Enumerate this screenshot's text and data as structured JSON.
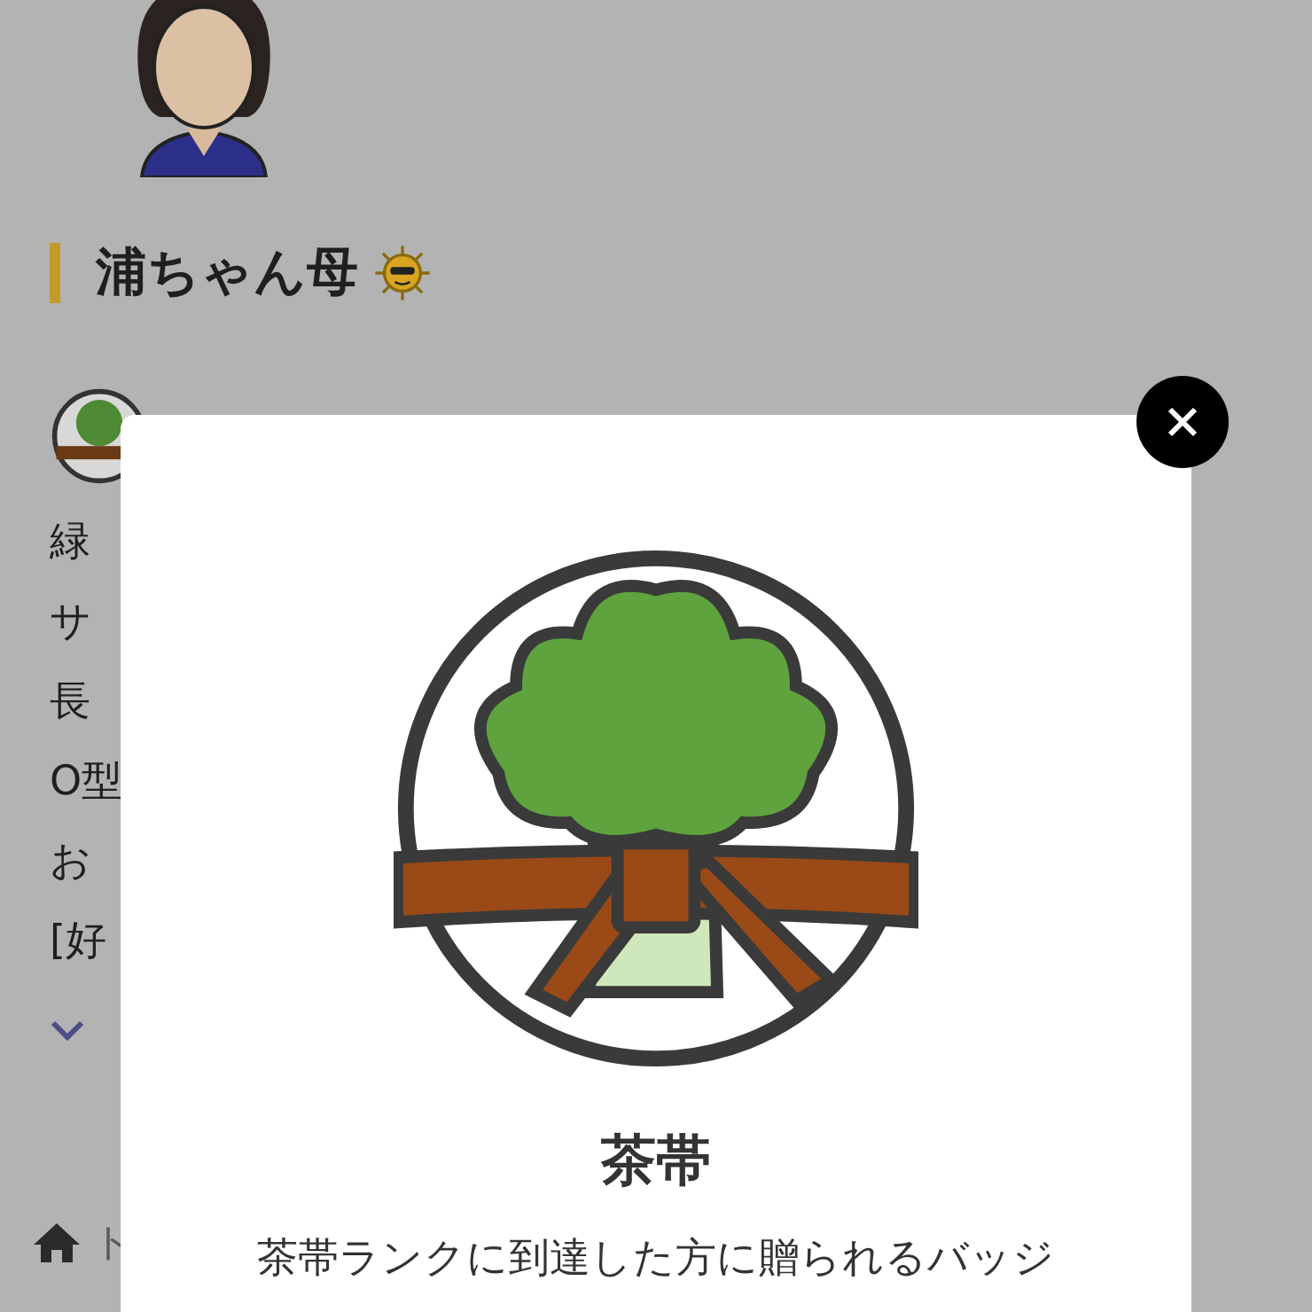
{
  "profile": {
    "name": "浦ちゃん母",
    "bio_lines": [
      "緑",
      "サ",
      "長",
      "O型",
      "お",
      "[好"
    ],
    "bottom_nav": {
      "label": "ト"
    }
  },
  "modal": {
    "title": "茶帯",
    "description": "茶帯ランクに到達した方に贈られるバッジ"
  }
}
